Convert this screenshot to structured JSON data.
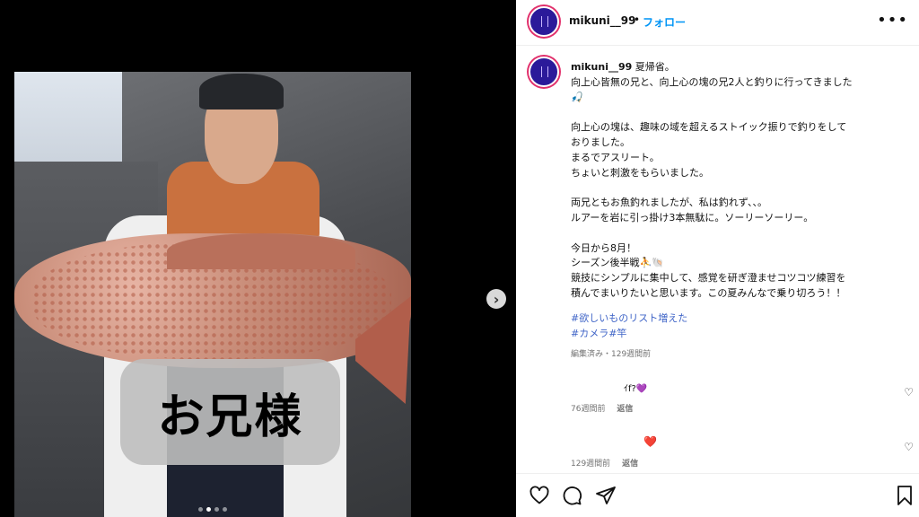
{
  "media": {
    "overlay_caption": "お兄様",
    "carousel_dots": 4,
    "active_dot": 1
  },
  "header": {
    "username": "mikuni__99",
    "separator": "•",
    "follow_label": "フォロー"
  },
  "caption": {
    "username": "mikuni__99",
    "text": " 夏帰省。\n向上心皆無の兄と、向上心の塊の兄2人と釣りに行ってきました\n🎣\n\n向上心の塊は、趣味の域を超えるストイック振りで釣りをして\nおりました。\nまるでアスリート。\nちょいと刺激をもらいました。\n\n両兄ともお魚釣れましたが、私は釣れず、、。\nルアーを岩に引っ掛け3本無駄に。ソーリーソーリー。\n\n今日から8月！\nシーズン後半戦⛹️🐚\n競技にシンプルに集中して、感覚を研ぎ澄ませコツコツ練習を\n積んでまいりたいと思います。この夏みんなで乗り切ろう！！",
    "hashtags": [
      "#欲しいものリスト増えた",
      "#カメラ#竿"
    ],
    "meta": "編集済み・129週間前"
  },
  "comments": [
    {
      "text": "ｲf?💜",
      "time": "76週間前",
      "reply_label": "返信"
    },
    {
      "text": "❤️",
      "time": "129週間前",
      "reply_label": "返信"
    }
  ],
  "colors": {
    "accent": "#0095f6",
    "hashtag": "#3f64c7",
    "muted": "#737373"
  },
  "icons": [
    "more-icon",
    "next-arrow-icon",
    "heart-icon",
    "comment-icon",
    "share-icon",
    "bookmark-icon"
  ]
}
